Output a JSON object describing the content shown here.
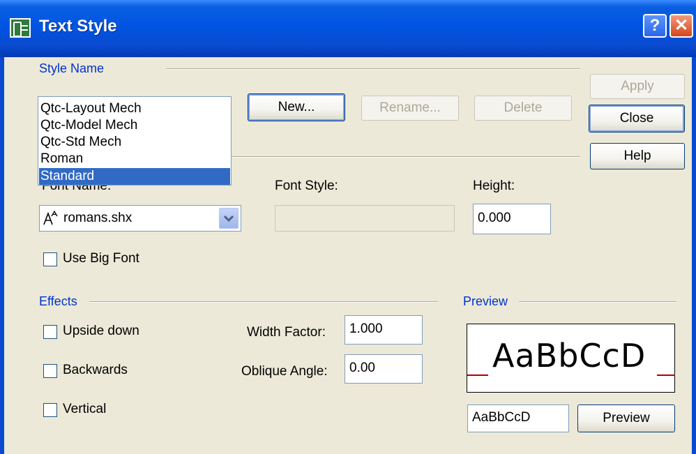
{
  "window": {
    "title": "Text Style",
    "help_glyph": "?",
    "close_glyph": "✕"
  },
  "style_name": {
    "label": "Style Name",
    "list": [
      "Qtc-Layout Mech",
      "Qtc-Model Mech",
      "Qtc-Std Mech",
      "Roman",
      "Standard"
    ],
    "selected": "Standard",
    "new_label": "New...",
    "rename_label": "Rename...",
    "delete_label": "Delete"
  },
  "side_buttons": {
    "apply": "Apply",
    "close": "Close",
    "help": "Help"
  },
  "font": {
    "font_name_label": "Font Name:",
    "font_name_value": "romans.shx",
    "font_style_label": "Font Style:",
    "font_style_value": "",
    "height_label": "Height:",
    "height_value": "0.000",
    "use_big_font_label": "Use Big Font",
    "use_big_font_checked": false
  },
  "effects": {
    "label": "Effects",
    "upside_down_label": "Upside down",
    "backwards_label": "Backwards",
    "vertical_label": "Vertical",
    "width_factor_label": "Width Factor:",
    "width_factor_value": "1.000",
    "oblique_angle_label": "Oblique Angle:",
    "oblique_angle_value": "0.00"
  },
  "preview": {
    "label": "Preview",
    "sample_text": "AaBbCcD",
    "input_value": "AaBbCcD",
    "button_label": "Preview",
    "baseline_color": "#b20000"
  },
  "colors": {
    "titlebar": "#0054e3",
    "group_label": "#0033cc",
    "dialog_bg": "#ece9d8",
    "selection": "#316ac5"
  }
}
